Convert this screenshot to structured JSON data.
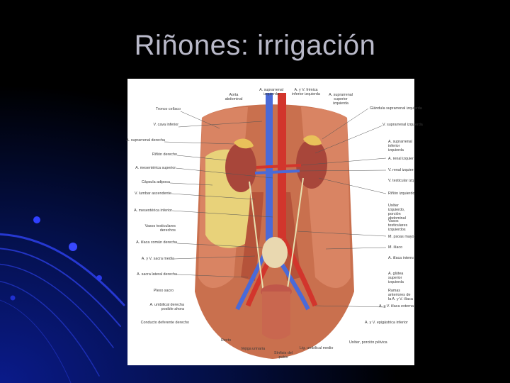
{
  "slide": {
    "title": "Riñones: irrigación",
    "colors": {
      "background": "#000000",
      "accent": "#1a2fd0",
      "title": "#b9b9c9"
    }
  },
  "figure": {
    "top_labels": [
      "Aorta abdominal",
      "A. suprarrenal izquierda",
      "A. y V. frénica inferior izquierda",
      "A. suprarrenal superior izquierda"
    ],
    "left_labels": [
      "Tronco celíaco",
      "V. cava inferior",
      "A. suprarrenal derecha",
      "Riñón derecho",
      "A. mesentérica superior",
      "Cápsula adiposa",
      "V. lumbar ascendente",
      "A. mesentérica inferior",
      "Vasos testiculares derechos",
      "A. ilíaca común derecha",
      "A. y V. sacra media",
      "A. sacra lateral derecha",
      "Plexo sacro",
      "A. umbilical derecha posible ahora",
      "Conducto deferente derecho"
    ],
    "right_labels": [
      "Glándula suprarrenal izquierda",
      "V. suprarrenal izquierda",
      "A. suprarrenal inferior izquierda",
      "A. renal izquierda",
      "V. renal izquierda",
      "V. testicular izquierda",
      "Riñón izquierdo",
      "Uréter izquierdo, porción abdominal",
      "Vasos testiculares izquierdos",
      "M. psoas mayor",
      "M. ilíaco",
      "A. ilíaca interna",
      "A. glútea superior izquierda",
      "Ramas anteriores de la A. y V. ilíaca",
      "A. y V. ilíaca externa",
      "A. y V. epigástrica inferior"
    ],
    "bottom_labels": [
      "Recto",
      "Vejiga urinaria",
      "Sínfisis del pubis",
      "Lig. umbilical medio",
      "Uréter, porción pélvica"
    ]
  }
}
